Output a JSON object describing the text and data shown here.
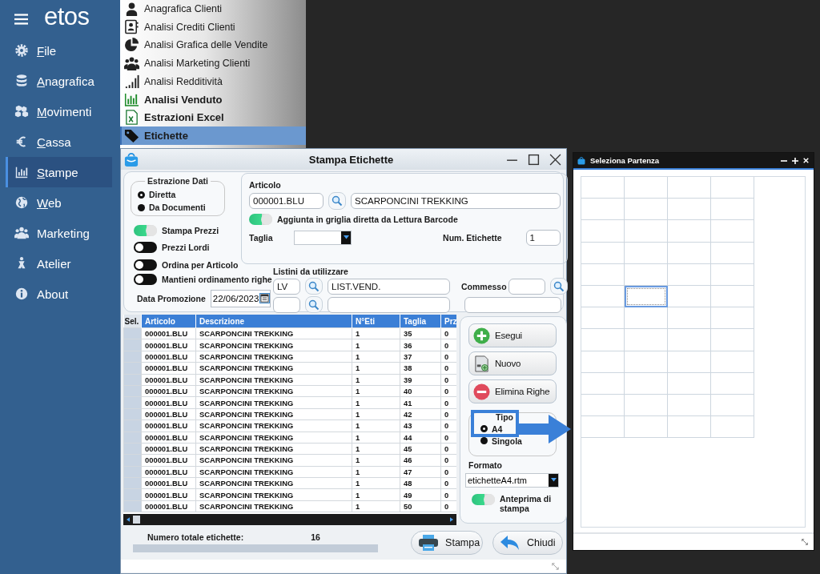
{
  "sidebar": {
    "logo": "etos",
    "items": [
      {
        "label": "File",
        "mnemonic": true,
        "selected": false
      },
      {
        "label": "Anagrafica",
        "mnemonic": true,
        "selected": false
      },
      {
        "label": "Movimenti",
        "mnemonic": true,
        "selected": false
      },
      {
        "label": "Cassa",
        "mnemonic": true,
        "selected": false
      },
      {
        "label": "Stampe",
        "mnemonic": true,
        "selected": true
      },
      {
        "label": "Web",
        "mnemonic": true,
        "selected": false
      },
      {
        "label": "Marketing",
        "mnemonic": false,
        "selected": false
      },
      {
        "label": "Atelier",
        "mnemonic": false,
        "selected": false
      },
      {
        "label": "About",
        "mnemonic": false,
        "selected": false
      }
    ]
  },
  "menu": {
    "items": [
      {
        "label": "Anagrafica Clienti",
        "bold": false,
        "selected": false
      },
      {
        "label": "Analisi Crediti Clienti",
        "bold": false,
        "selected": false
      },
      {
        "label": "Analisi Grafica delle Vendite",
        "bold": false,
        "selected": false
      },
      {
        "label": "Analisi Marketing Clienti",
        "bold": false,
        "selected": false
      },
      {
        "label": "Analisi Redditività",
        "bold": false,
        "selected": false
      },
      {
        "label": "Analisi Venduto",
        "bold": true,
        "selected": false
      },
      {
        "label": "Estrazioni Excel",
        "bold": true,
        "selected": false
      },
      {
        "label": "Etichette",
        "bold": true,
        "selected": true
      }
    ]
  },
  "dialog": {
    "title": "Stampa Etichette",
    "extraction": {
      "title": "Estrazione Dati",
      "options": [
        {
          "label": "Diretta",
          "selected": true
        },
        {
          "label": "Da Documenti",
          "selected": false
        }
      ]
    },
    "toggles": [
      {
        "label": "Stampa Prezzi",
        "on": true
      },
      {
        "label": "Prezzi Lordi",
        "on": false
      },
      {
        "label": "Ordina per Articolo",
        "on": false
      },
      {
        "label": "Mantieni ordinamento righe",
        "on": false
      }
    ],
    "promo_date": {
      "label": "Data Promozione",
      "value": "22/06/2023"
    },
    "article": {
      "label": "Articolo",
      "code": "000001.BLU",
      "description": "SCARPONCINI TREKKING",
      "barcode_toggle": {
        "label": "Aggiunta in griglia diretta da Lettura Barcode",
        "on": true
      },
      "size_label": "Taglia",
      "count_label": "Num. Etichette",
      "count": "1"
    },
    "price_lists": {
      "label": "Listini da utilizzare",
      "code": "LV",
      "name": "LIST.VEND."
    },
    "clerk": {
      "label": "Commesso"
    },
    "table": {
      "columns": [
        "Sel.",
        "Articolo",
        "Descrizione",
        "N°Eti",
        "Taglia",
        "Prz"
      ],
      "rows": [
        {
          "article": "000001.BLU",
          "description": "SCARPONCINI TREKKING",
          "count": "1",
          "size": "35",
          "price": "0"
        },
        {
          "article": "000001.BLU",
          "description": "SCARPONCINI TREKKING",
          "count": "1",
          "size": "36",
          "price": "0"
        },
        {
          "article": "000001.BLU",
          "description": "SCARPONCINI TREKKING",
          "count": "1",
          "size": "37",
          "price": "0"
        },
        {
          "article": "000001.BLU",
          "description": "SCARPONCINI TREKKING",
          "count": "1",
          "size": "38",
          "price": "0"
        },
        {
          "article": "000001.BLU",
          "description": "SCARPONCINI TREKKING",
          "count": "1",
          "size": "39",
          "price": "0"
        },
        {
          "article": "000001.BLU",
          "description": "SCARPONCINI TREKKING",
          "count": "1",
          "size": "40",
          "price": "0"
        },
        {
          "article": "000001.BLU",
          "description": "SCARPONCINI TREKKING",
          "count": "1",
          "size": "41",
          "price": "0"
        },
        {
          "article": "000001.BLU",
          "description": "SCARPONCINI TREKKING",
          "count": "1",
          "size": "42",
          "price": "0"
        },
        {
          "article": "000001.BLU",
          "description": "SCARPONCINI TREKKING",
          "count": "1",
          "size": "43",
          "price": "0"
        },
        {
          "article": "000001.BLU",
          "description": "SCARPONCINI TREKKING",
          "count": "1",
          "size": "44",
          "price": "0"
        },
        {
          "article": "000001.BLU",
          "description": "SCARPONCINI TREKKING",
          "count": "1",
          "size": "45",
          "price": "0"
        },
        {
          "article": "000001.BLU",
          "description": "SCARPONCINI TREKKING",
          "count": "1",
          "size": "46",
          "price": "0"
        },
        {
          "article": "000001.BLU",
          "description": "SCARPONCINI TREKKING",
          "count": "1",
          "size": "47",
          "price": "0"
        },
        {
          "article": "000001.BLU",
          "description": "SCARPONCINI TREKKING",
          "count": "1",
          "size": "48",
          "price": "0"
        },
        {
          "article": "000001.BLU",
          "description": "SCARPONCINI TREKKING",
          "count": "1",
          "size": "49",
          "price": "0"
        },
        {
          "article": "000001.BLU",
          "description": "SCARPONCINI TREKKING",
          "count": "1",
          "size": "50",
          "price": "0"
        }
      ]
    },
    "actions": [
      {
        "label": "Esegui",
        "kind": "add"
      },
      {
        "label": "Nuovo",
        "kind": "new"
      },
      {
        "label": "Elimina Righe",
        "kind": "delete"
      }
    ],
    "type": {
      "title": "Tipo",
      "options": [
        {
          "label": "A4",
          "selected": true
        },
        {
          "label": "Singola",
          "selected": false
        }
      ]
    },
    "format": {
      "label": "Formato",
      "value": "etichetteA4.rtm"
    },
    "preview_toggle": {
      "label": "Anteprima di stampa",
      "on": true
    },
    "total": {
      "label": "Numero totale etichette:",
      "value": "16"
    },
    "footer_buttons": [
      {
        "label": "Stampa",
        "kind": "print"
      },
      {
        "label": "Chiudi",
        "kind": "close"
      }
    ]
  },
  "start_picker": {
    "title": "Seleziona Partenza",
    "rows": [
      {
        "cells": [
          {
            "selected": false
          },
          {
            "selected": false
          },
          {
            "selected": false
          },
          {
            "selected": false
          }
        ]
      },
      {
        "cells": [
          {
            "selected": false
          },
          {
            "selected": false
          },
          {
            "selected": false
          },
          {
            "selected": false
          }
        ]
      },
      {
        "cells": [
          {
            "selected": false
          },
          {
            "selected": false
          },
          {
            "selected": false
          },
          {
            "selected": false
          }
        ]
      },
      {
        "cells": [
          {
            "selected": false
          },
          {
            "selected": false
          },
          {
            "selected": false
          },
          {
            "selected": false
          }
        ]
      },
      {
        "cells": [
          {
            "selected": false
          },
          {
            "selected": false
          },
          {
            "selected": false
          },
          {
            "selected": false
          }
        ]
      },
      {
        "cells": [
          {
            "selected": false
          },
          {
            "selected": true
          },
          {
            "selected": false
          },
          {
            "selected": false
          }
        ]
      },
      {
        "cells": [
          {
            "selected": false
          },
          {
            "selected": false
          },
          {
            "selected": false
          },
          {
            "selected": false
          }
        ]
      },
      {
        "cells": [
          {
            "selected": false
          },
          {
            "selected": false
          },
          {
            "selected": false
          },
          {
            "selected": false
          }
        ]
      },
      {
        "cells": [
          {
            "selected": false
          },
          {
            "selected": false
          },
          {
            "selected": false
          },
          {
            "selected": false
          }
        ]
      },
      {
        "cells": [
          {
            "selected": false
          },
          {
            "selected": false
          },
          {
            "selected": false
          },
          {
            "selected": false
          }
        ]
      },
      {
        "cells": [
          {
            "selected": false
          },
          {
            "selected": false
          },
          {
            "selected": false
          },
          {
            "selected": false
          }
        ]
      },
      {
        "cells": [
          {
            "selected": false
          },
          {
            "selected": false
          },
          {
            "selected": false
          },
          {
            "selected": false
          }
        ]
      }
    ]
  }
}
